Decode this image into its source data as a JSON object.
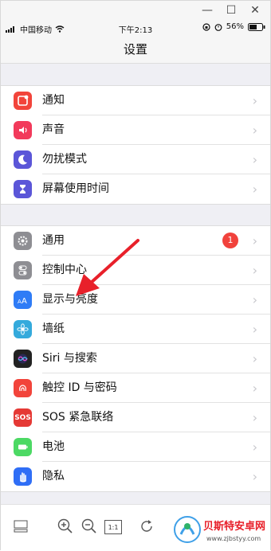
{
  "window": {
    "minimize": "—",
    "maximize": "☐",
    "close": "✕"
  },
  "status": {
    "carrier": "中国移动",
    "time": "下午2:13",
    "battery": "56%"
  },
  "nav": {
    "title": "设置"
  },
  "group1": [
    {
      "label": "通知",
      "icon": "notification-icon",
      "color": "#f2443b"
    },
    {
      "label": "声音",
      "icon": "sound-icon",
      "color": "#f23a5b"
    },
    {
      "label": "勿扰模式",
      "icon": "moon-icon",
      "color": "#5b56d8"
    },
    {
      "label": "屏幕使用时间",
      "icon": "hourglass-icon",
      "color": "#5b56d8"
    }
  ],
  "group2": [
    {
      "label": "通用",
      "icon": "gear-icon",
      "color": "#8e8e93",
      "badge": "1"
    },
    {
      "label": "控制中心",
      "icon": "toggles-icon",
      "color": "#8e8e93"
    },
    {
      "label": "显示与亮度",
      "icon": "text-size-icon",
      "color": "#2f7cf6"
    },
    {
      "label": "墙纸",
      "icon": "flower-icon",
      "color": "#34aadc"
    },
    {
      "label": "Siri 与搜索",
      "icon": "siri-icon",
      "color": "#222222"
    },
    {
      "label": "触控 ID 与密码",
      "icon": "fingerprint-icon",
      "color": "#f2443b"
    },
    {
      "label": "SOS 紧急联络",
      "icon": "sos-icon",
      "color": "#e53935",
      "icon_text": "SOS"
    },
    {
      "label": "电池",
      "icon": "battery-icon",
      "color": "#4cd964"
    },
    {
      "label": "隐私",
      "icon": "hand-icon",
      "color": "#2f6ef6"
    }
  ],
  "toolbar": {
    "fit_label": "1:1"
  },
  "watermark": {
    "title": "贝斯特安卓网",
    "url": "www.zjbstyy.com"
  }
}
